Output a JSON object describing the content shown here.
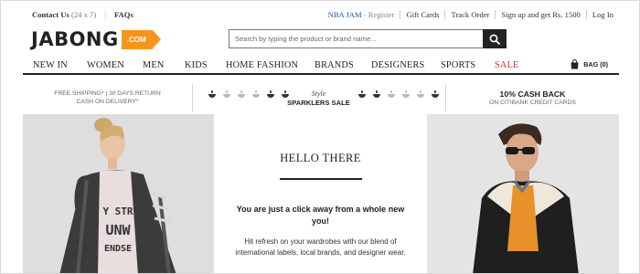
{
  "topbar": {
    "contact_label": "Contact Us",
    "contact_hours": "(24 x 7)",
    "separator": "|",
    "faqs_label": "FAQs",
    "nba_label": "NBA JAM",
    "register_label": "- Register",
    "gift_cards_label": "Gift Cards",
    "track_order_label": "Track Order",
    "signup_label": "Sign up and get Rs. 1500",
    "login_label": "Log In"
  },
  "logo": {
    "wordmark": "JABONG",
    "tag": ".COM"
  },
  "search": {
    "placeholder": "Search by typing the product or brand name...",
    "value": ""
  },
  "nav": {
    "items": [
      "NEW IN",
      "WOMEN",
      "MEN",
      "KIDS",
      "HOME FASHION",
      "BRANDS",
      "DESIGNERS",
      "SPORTS",
      "SALE"
    ],
    "bag_label": "BAG (0)"
  },
  "promo": {
    "shipping_line1": "FREE SHIPPING* | 30 DAYS RETURN",
    "shipping_line2": "CASH ON DELIVERY*",
    "sparklers_style": "Style",
    "sparklers_title": "SPARKLERS SALE",
    "cashback_title": "10% CASH BACK",
    "cashback_sub": "ON CITIBANK CREDIT CARDS"
  },
  "hero": {
    "heading": "HELLO THERE",
    "lead": "You are just a click away from a whole new you!",
    "body": "Hit refresh on your wardrobes with our blend of international labels, local brands, and designer wear."
  },
  "colors": {
    "brand_orange": "#f7941d",
    "sale_red": "#d12c2c",
    "link_blue": "#1a5aa8",
    "dark": "#222222"
  }
}
